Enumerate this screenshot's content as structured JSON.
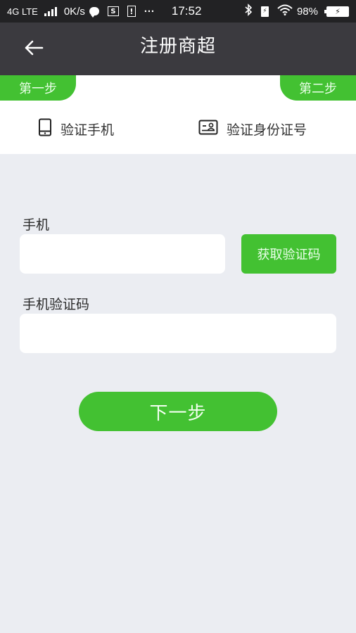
{
  "status_bar": {
    "network": "4G LTE",
    "speed": "0K/s",
    "s_icon_letter": "S",
    "alert_icon_letter": "!",
    "more": "···",
    "time": "17:52",
    "battery_percent": "98%"
  },
  "nav": {
    "title": "注册商超",
    "back_icon": "arrow-left-icon"
  },
  "steps": {
    "step1_label": "第一步",
    "step2_label": "第二步"
  },
  "verify": {
    "phone_label": "验证手机",
    "phone_icon": "mobile-phone-icon",
    "id_label": "验证身份证号",
    "id_icon": "id-card-icon"
  },
  "form": {
    "phone_label": "手机",
    "phone_value": "",
    "phone_placeholder": "",
    "get_code_button": "获取验证码",
    "code_label": "手机验证码",
    "code_value": "",
    "code_placeholder": ""
  },
  "actions": {
    "next_button": "下一步"
  },
  "colors": {
    "accent_green": "#43c132",
    "nav_bg": "#3b3a3f",
    "status_bg": "#222224",
    "page_bg": "#ebedf2"
  }
}
